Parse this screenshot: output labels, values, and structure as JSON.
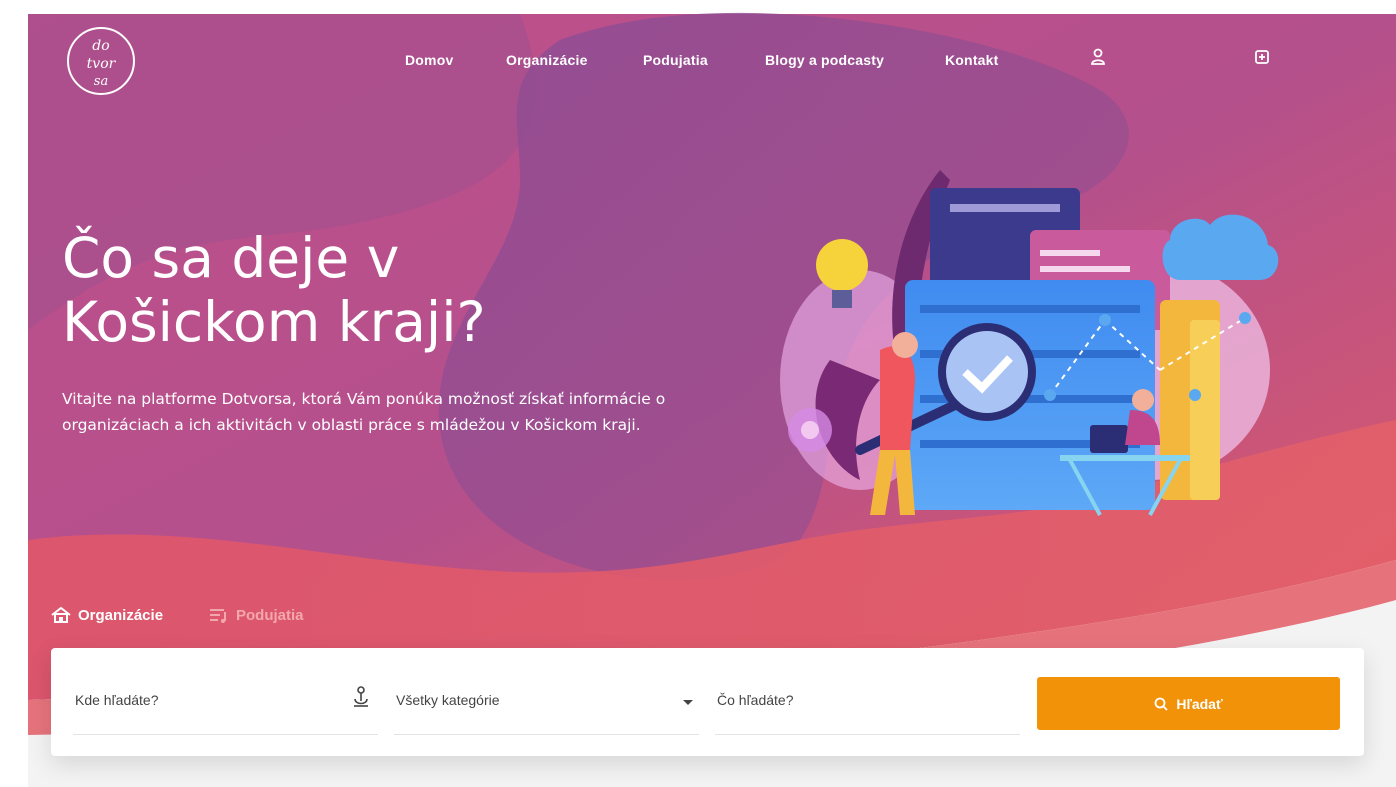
{
  "brand": {
    "logo_text": "do tvor sa"
  },
  "nav": {
    "items": [
      {
        "label": "Domov"
      },
      {
        "label": "Organizácie"
      },
      {
        "label": "Podujatia"
      },
      {
        "label": "Blogy a podcasty"
      },
      {
        "label": "Kontakt"
      }
    ],
    "user_icon": "user-icon",
    "add_icon": "plus-square-icon"
  },
  "hero": {
    "title_line1": "Čo sa deje v",
    "title_line2": "Košickom kraji?",
    "intro": "Vitajte na platforme Dotvorsa, ktorá Vám ponúka možnosť získať informácie o organizáciach a ich aktivitách v oblasti práce s mládežou v Košickom kraji."
  },
  "tabs": [
    {
      "label": "Organizácie",
      "icon": "home-icon",
      "active": true
    },
    {
      "label": "Podujatia",
      "icon": "list-icon",
      "active": false
    }
  ],
  "search": {
    "where_placeholder": "Kde hľadáte?",
    "category_value": "Všetky kategórie",
    "what_placeholder": "Čo hľadáte?",
    "button_label": "Hľadať",
    "button_icon": "search-icon"
  },
  "colors": {
    "accent": "#f29209",
    "hero_top": "#b24d8e",
    "hero_bottom": "#e25a62"
  }
}
